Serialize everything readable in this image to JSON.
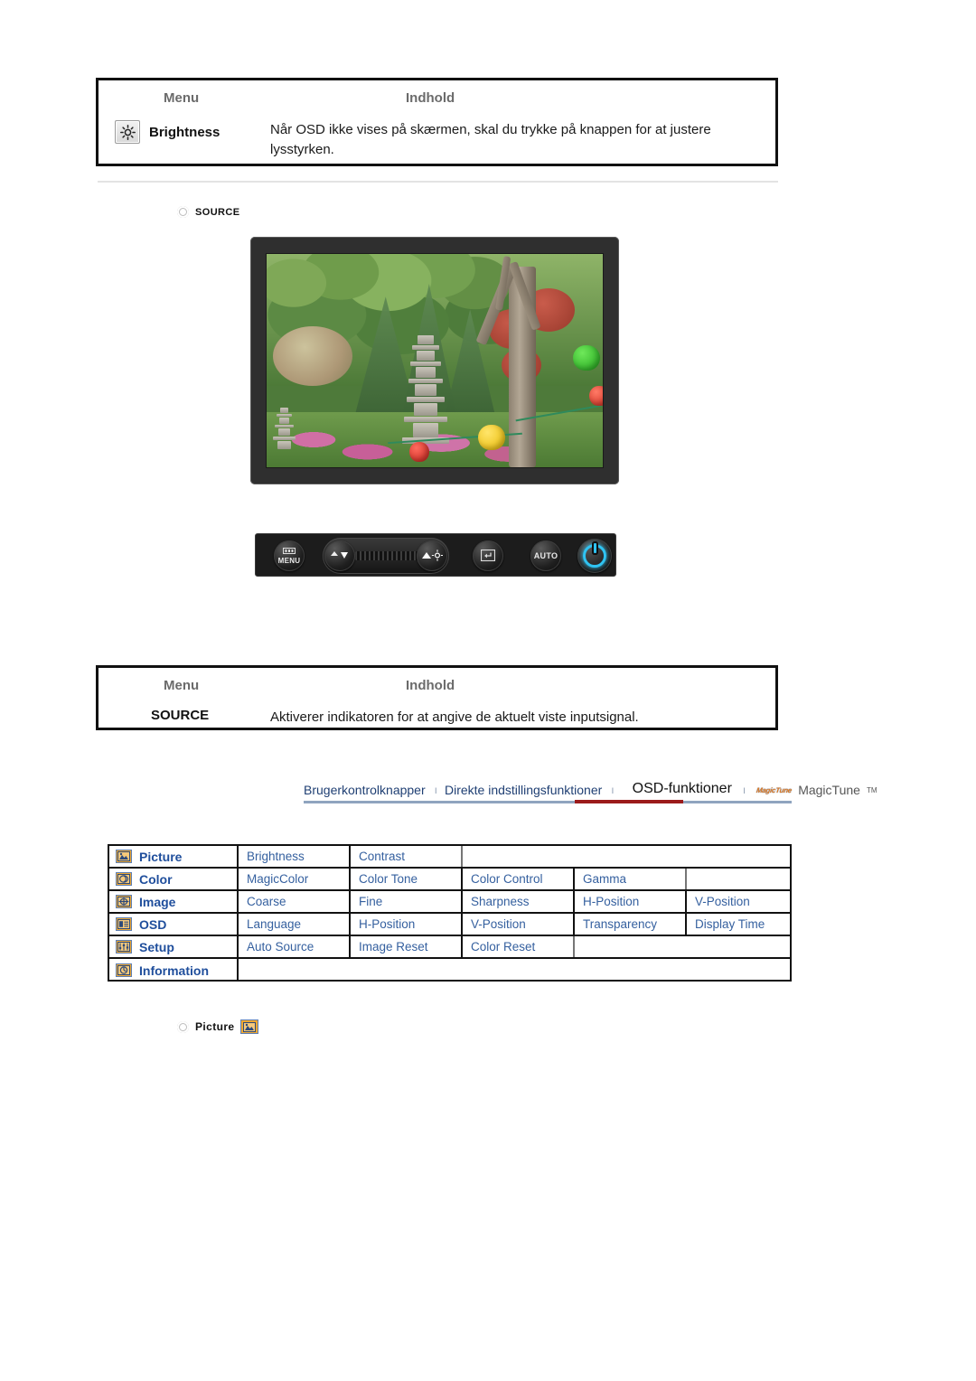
{
  "table_brightness": {
    "header_menu": "Menu",
    "header_content": "Indhold",
    "icon": "brightness-sun-icon",
    "row_label": "Brightness",
    "row_description": "Når OSD ikke vises på skærmen, skal du trykke på knappen for at justere lysstyrken."
  },
  "source_section": {
    "heading": "SOURCE",
    "bullet_icon": "bullet-dot-icon"
  },
  "monitor": {
    "photo_alt": "Korean garden with stone pagoda, trees and paper lanterns"
  },
  "button_bar": {
    "buttons": [
      {
        "name": "menu-button",
        "label": "MENU",
        "icon": "menu-bars-icon"
      },
      {
        "name": "brightness-down-button",
        "label": "",
        "icon": "down-arrow-icon"
      },
      {
        "name": "brightness-up-button",
        "label": "",
        "icon": "up-arrow-sun-icon"
      },
      {
        "name": "enter-source-button",
        "label": "",
        "icon": "enter-return-icon"
      },
      {
        "name": "auto-button",
        "label": "AUTO",
        "icon": "auto-text-icon"
      },
      {
        "name": "power-button",
        "label": "",
        "icon": "power-icon"
      }
    ],
    "power_color": "#2fc3f2"
  },
  "table_source": {
    "header_menu": "Menu",
    "header_content": "Indhold",
    "row_label": "SOURCE",
    "row_description": "Aktiverer indikatoren for at angive de aktuelt viste inputsignal."
  },
  "navbar": {
    "items": [
      {
        "label": "Brugerkontrolknapper",
        "active": false
      },
      {
        "label": "Direkte indstillingsfunktioner",
        "active": false
      },
      {
        "label": "OSD-funktioner",
        "active": true
      },
      {
        "label": "MagicTune",
        "active": false,
        "logo": "magictune-logo",
        "tm": "TM"
      }
    ],
    "separator": "ı",
    "active_underline_color": "#9b1b1b",
    "underline_color": "#8fa4bf"
  },
  "osd_table": {
    "rows": [
      {
        "icon": "picture-icon",
        "category": "Picture",
        "items": [
          "Brightness",
          "Contrast"
        ]
      },
      {
        "icon": "color-icon",
        "category": "Color",
        "items": [
          "MagicColor",
          "Color Tone",
          "Color Control",
          "Gamma"
        ]
      },
      {
        "icon": "image-icon",
        "category": "Image",
        "items": [
          "Coarse",
          "Fine",
          "Sharpness",
          "H-Position",
          "V-Position"
        ]
      },
      {
        "icon": "osd-icon",
        "category": "OSD",
        "items": [
          "Language",
          "H-Position",
          "V-Position",
          "Transparency",
          "Display Time"
        ]
      },
      {
        "icon": "setup-icon",
        "category": "Setup",
        "items": [
          "Auto Source",
          "Image Reset",
          "Color Reset"
        ]
      },
      {
        "icon": "information-icon",
        "category": "Information",
        "items": []
      }
    ],
    "max_columns": 5,
    "text_color": "#35609f",
    "category_color": "#1f4e9c",
    "icon_color": "#f0a830"
  },
  "picture_section": {
    "heading": "Picture",
    "bullet_icon": "bullet-dot-icon",
    "badge_icon": "picture-icon"
  }
}
